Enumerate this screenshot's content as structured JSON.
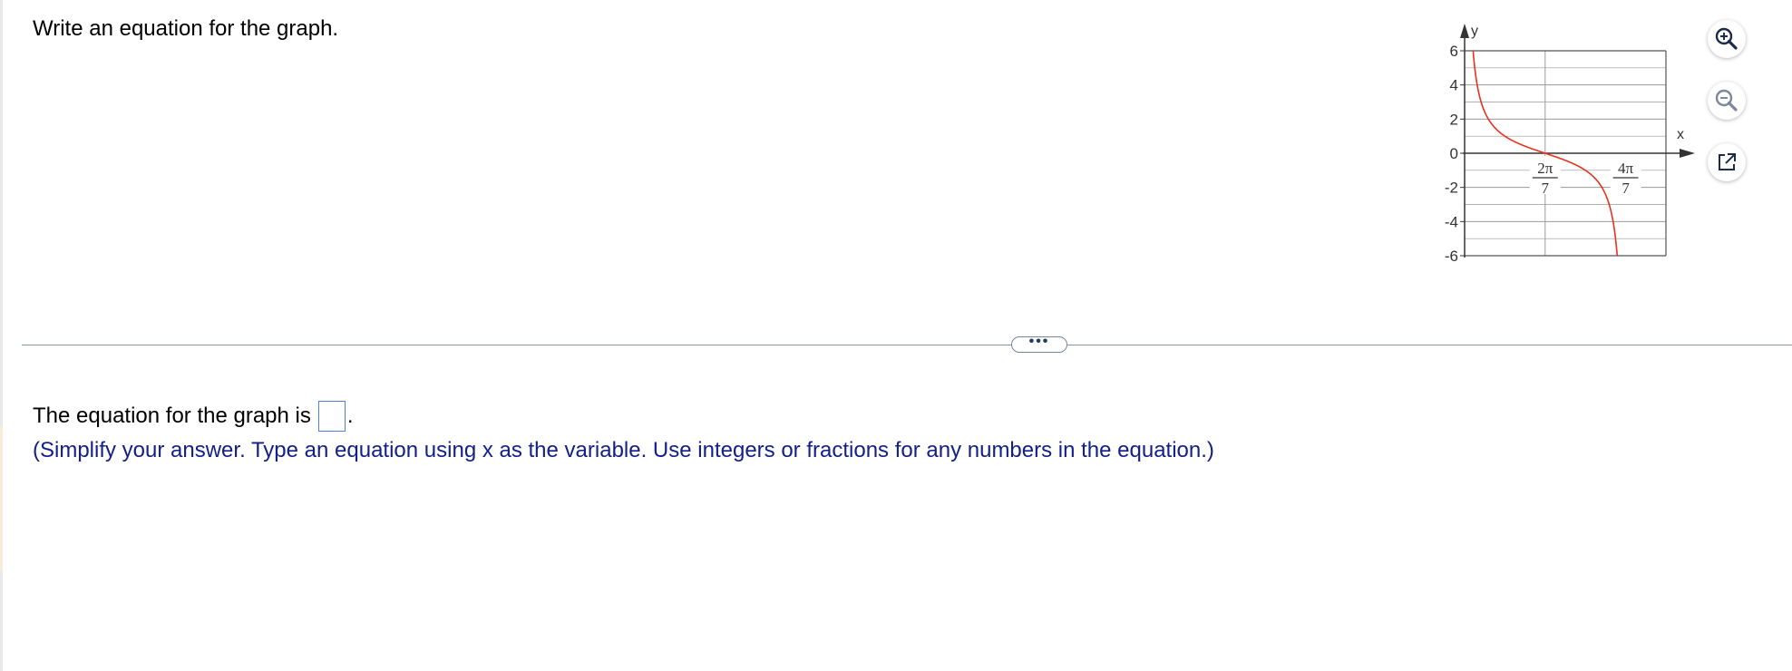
{
  "question": {
    "prompt": "Write an equation for the graph."
  },
  "graph": {
    "x_axis_label": "x",
    "y_axis_label": "y",
    "y_tick_labels": [
      "6",
      "4",
      "2",
      "0",
      "-2",
      "-4",
      "-6"
    ],
    "x_tick_labels": [
      {
        "numerator": "2π",
        "denominator": "7"
      },
      {
        "numerator": "4π",
        "denominator": "7"
      }
    ],
    "curve_color": "#e8311f"
  },
  "toolbar": {
    "zoom_in_icon": "zoom-in-icon",
    "zoom_out_icon": "zoom-out-icon",
    "popout_icon": "popout-icon"
  },
  "answer": {
    "lead_text": "The equation for the graph is",
    "period": ".",
    "instructions": "(Simplify your answer. Type an equation using x as the variable. Use integers or fractions for any numbers in the equation.)"
  }
}
